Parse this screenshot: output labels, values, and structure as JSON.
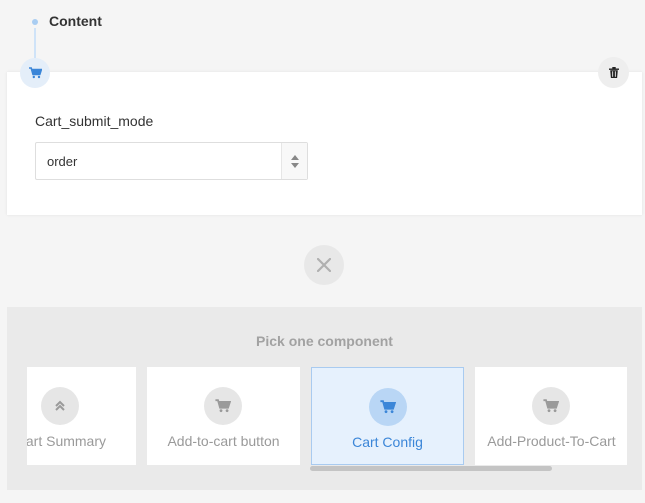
{
  "section": {
    "title": "Content"
  },
  "field": {
    "label": "Cart_submit_mode",
    "value": "order"
  },
  "picker": {
    "title": "Pick one component",
    "components": [
      {
        "label": "Cart Summary",
        "icon": "double-chevron-up-icon"
      },
      {
        "label": "Add-to-cart button",
        "icon": "cart-icon"
      },
      {
        "label": "Cart Config",
        "icon": "cart-icon",
        "selected": true
      },
      {
        "label": "Add-Product-To-Cart",
        "icon": "cart-icon"
      }
    ]
  },
  "colors": {
    "accent": "#3b86d8",
    "active_bg": "#e6f1fd",
    "badge_bg": "#e4eef9"
  }
}
